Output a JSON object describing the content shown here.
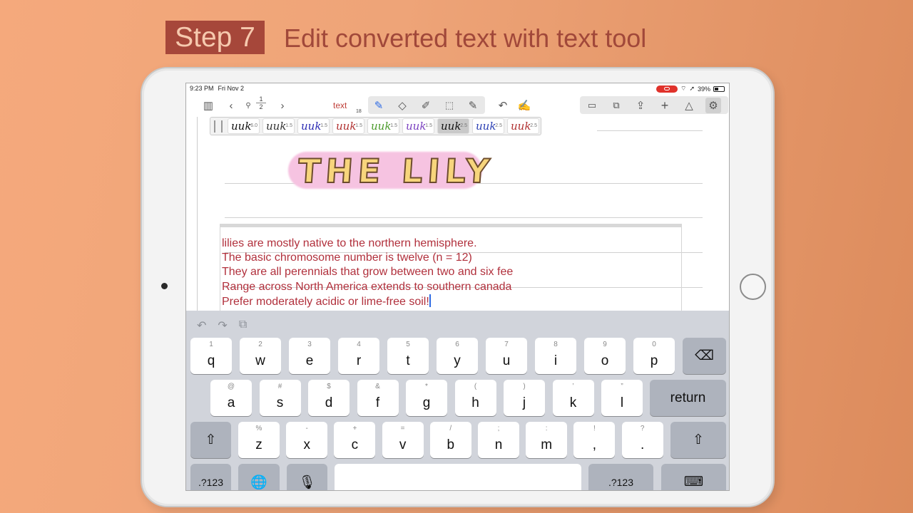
{
  "header": {
    "step_badge": "Step 7",
    "title": "Edit converted text with text tool"
  },
  "status_bar": {
    "time": "9:23 PM",
    "date": "Fri Nov 2",
    "battery": "39%"
  },
  "toolbar": {
    "page_current": "1",
    "page_total": "2",
    "text_label": "text",
    "text_count": "18",
    "icons": [
      "library-icon",
      "back-icon",
      "search-icon",
      "forward-icon",
      "pen-icon",
      "eraser-icon",
      "highlighter-icon",
      "lasso-icon",
      "marker-icon",
      "undo-icon",
      "laser-pointer-icon",
      "add-page-icon",
      "templates-icon",
      "share-icon",
      "add-icon",
      "shapes-icon",
      "settings-icon"
    ]
  },
  "pens": [
    {
      "color": "#111111",
      "width": "6.0"
    },
    {
      "color": "#333333",
      "width": "1.5"
    },
    {
      "color": "#2b2bb3",
      "width": "1.5"
    },
    {
      "color": "#b03030",
      "width": "1.5"
    },
    {
      "color": "#4a9a2a",
      "width": "1.5"
    },
    {
      "color": "#7a40c0",
      "width": "1.5"
    },
    {
      "color": "#111111",
      "width": "2.5"
    },
    {
      "color": "#2b3fb3",
      "width": "2.5"
    },
    {
      "color": "#b03030",
      "width": "2.5"
    }
  ],
  "pen_glyph": "uuk",
  "note": {
    "heading": "THE LILY",
    "lines": [
      "lilies are mostly native to the northern hemisphere.",
      "The basic chromosome number is twelve (n = 12)",
      "They are all perennials that grow between two and six fee",
      "Range across North America extends to southern canada",
      "Prefer moderately acidic or lime-free soil!"
    ]
  },
  "keyboard": {
    "row1": [
      [
        "1",
        "q"
      ],
      [
        "2",
        "w"
      ],
      [
        "3",
        "e"
      ],
      [
        "4",
        "r"
      ],
      [
        "5",
        "t"
      ],
      [
        "6",
        "y"
      ],
      [
        "7",
        "u"
      ],
      [
        "8",
        "i"
      ],
      [
        "9",
        "o"
      ],
      [
        "0",
        "p"
      ]
    ],
    "row2": [
      [
        "@",
        "a"
      ],
      [
        "#",
        "s"
      ],
      [
        "$",
        "d"
      ],
      [
        "&",
        "f"
      ],
      [
        "*",
        "g"
      ],
      [
        "(",
        "h"
      ],
      [
        ")",
        "j"
      ],
      [
        "’",
        "k"
      ],
      [
        "”",
        "l"
      ]
    ],
    "row3": [
      [
        "%",
        "z"
      ],
      [
        "-",
        "x"
      ],
      [
        "+",
        "c"
      ],
      [
        "=",
        "v"
      ],
      [
        "/",
        "b"
      ],
      [
        ";",
        "n"
      ],
      [
        ":",
        "m"
      ],
      [
        "!",
        ","
      ],
      [
        "?",
        "."
      ]
    ],
    "return": "return",
    "numbers": ".?123"
  }
}
